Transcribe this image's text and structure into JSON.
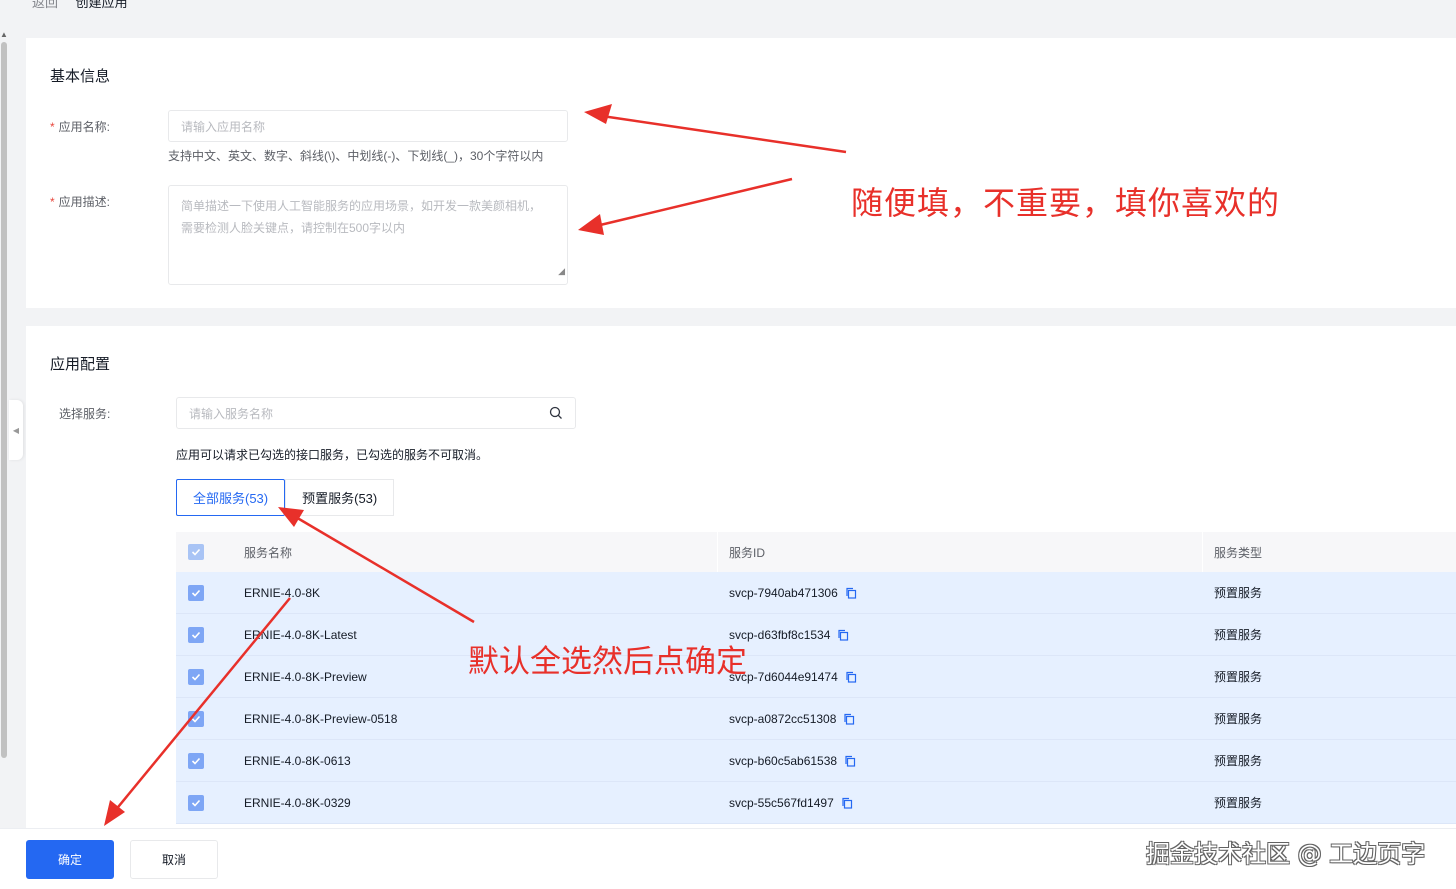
{
  "breadcrumb": {
    "back": "返回",
    "current": "创建应用"
  },
  "basic_info": {
    "title": "基本信息",
    "name_label": "应用名称:",
    "name_placeholder": "请输入应用名称",
    "name_hint": "支持中文、英文、数字、斜线(\\)、中划线(-)、下划线(_)，30个字符以内",
    "desc_label": "应用描述:",
    "desc_placeholder_line1": "简单描述一下使用人工智能服务的应用场景，如开发一款美颜相机，",
    "desc_placeholder_line2": "需要检测人脸关键点，请控制在500字以内"
  },
  "app_config": {
    "title": "应用配置",
    "service_label": "选择服务:",
    "search_placeholder": "请输入服务名称",
    "hint": "应用可以请求已勾选的接口服务，已勾选的服务不可取消。",
    "tabs": [
      {
        "label": "全部服务(53)",
        "active": true
      },
      {
        "label": "预置服务(53)",
        "active": false
      }
    ],
    "table": {
      "headers": [
        "服务名称",
        "服务ID",
        "服务类型"
      ],
      "rows": [
        {
          "name": "ERNIE-4.0-8K",
          "id": "svcp-7940ab471306",
          "type": "预置服务",
          "checked": true
        },
        {
          "name": "ERNIE-4.0-8K-Latest",
          "id": "svcp-d63fbf8c1534",
          "type": "预置服务",
          "checked": true
        },
        {
          "name": "ERNIE-4.0-8K-Preview",
          "id": "svcp-7d6044e91474",
          "type": "预置服务",
          "checked": true
        },
        {
          "name": "ERNIE-4.0-8K-Preview-0518",
          "id": "svcp-a0872cc51308",
          "type": "预置服务",
          "checked": true
        },
        {
          "name": "ERNIE-4.0-8K-0613",
          "id": "svcp-b60c5ab61538",
          "type": "预置服务",
          "checked": true
        },
        {
          "name": "ERNIE-4.0-8K-0329",
          "id": "svcp-55c567fd1497",
          "type": "预置服务",
          "checked": true
        }
      ]
    }
  },
  "footer": {
    "confirm": "确定",
    "cancel": "取消"
  },
  "annotations": {
    "note1": "随便填，不重要，填你喜欢的",
    "note2": "默认全选然后点确定"
  },
  "watermark": "掘金技术社区 @ 工边页字",
  "colors": {
    "primary": "#2468f2",
    "annotation": "#e8302a",
    "row_selected": "#e6f0ff"
  }
}
